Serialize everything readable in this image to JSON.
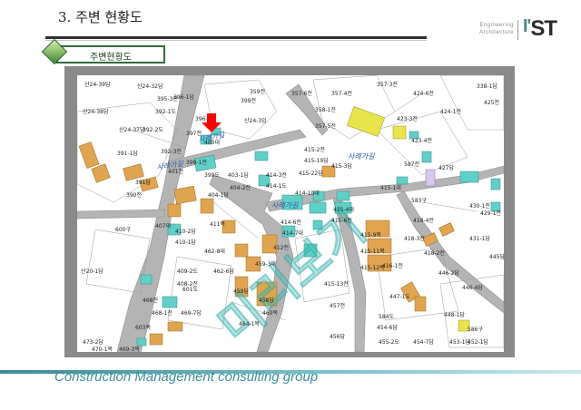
{
  "slide": {
    "title": "3. 주변 현황도",
    "section_tag": "주변현황도"
  },
  "brand": {
    "subtitle_line1": "Engineering",
    "subtitle_line2": "Architecture",
    "logo_main": "ST",
    "logo_accent": "I'"
  },
  "footer": {
    "text": "Construction Management  consulting group"
  },
  "map": {
    "area_label_1": "사례가길",
    "area_label_2": "사례가길",
    "area_label_3": "사례가길",
    "area_label_4": "사례가길",
    "watermark": "미리보기",
    "marker_icon": "red-down-arrow",
    "colors": {
      "building_orange": "#e0a44e",
      "building_cyan": "#5fd0c8",
      "building_yellow": "#e9e44a",
      "road_gray": "#b4b4b4",
      "marker_red": "#ff0000",
      "watermark_teal": "#3fc6c0"
    },
    "parcels": [
      "산24-39답",
      "산24-32답",
      "산24-38답",
      "396-1답",
      "395-3전",
      "392-1도",
      "396-1전",
      "397전",
      "399전",
      "359전",
      "357-6전",
      "357-4전",
      "357-3전",
      "424-6전",
      "338-1답",
      "425전",
      "424-1전",
      "358-1전",
      "423-3전",
      "423-4전",
      "산24-37답",
      "392-2도",
      "391-1답",
      "392-3전",
      "399-1전",
      "401전",
      "400대",
      "산24-3임",
      "357-5전",
      "415-2전",
      "415-19답",
      "415-3답",
      "587전",
      "427답",
      "391답",
      "390전",
      "399도",
      "403-1답",
      "404-2전",
      "404-1답",
      "414-3전",
      "414-1도",
      "414-10대",
      "415-22답",
      "415-1대",
      "415-4대",
      "415-6전",
      "583구",
      "430-1전",
      "429-1전",
      "600구",
      "407대",
      "411목",
      "410-2답",
      "410-1답",
      "412전",
      "462-8대",
      "414-6전",
      "414-7대",
      "418-4전",
      "418-3전",
      "418-2전",
      "431-1답",
      "445답",
      "산20-1답",
      "409-2도",
      "408-2전",
      "462-6답",
      "459-3대",
      "415-9목",
      "415-11목",
      "415-12목",
      "416-1전",
      "446-2답",
      "601도",
      "459답",
      "458답",
      "415-13전",
      "447-1도",
      "446-4답",
      "468전",
      "468-1전",
      "469-7답",
      "460목",
      "457전",
      "584도",
      "448-1답",
      "454-6답",
      "586구",
      "455-2도",
      "473-2답",
      "470-1목",
      "469-3목",
      "464-1목",
      "456답",
      "454-7답",
      "453-1답",
      "452-1답",
      "603목"
    ]
  }
}
